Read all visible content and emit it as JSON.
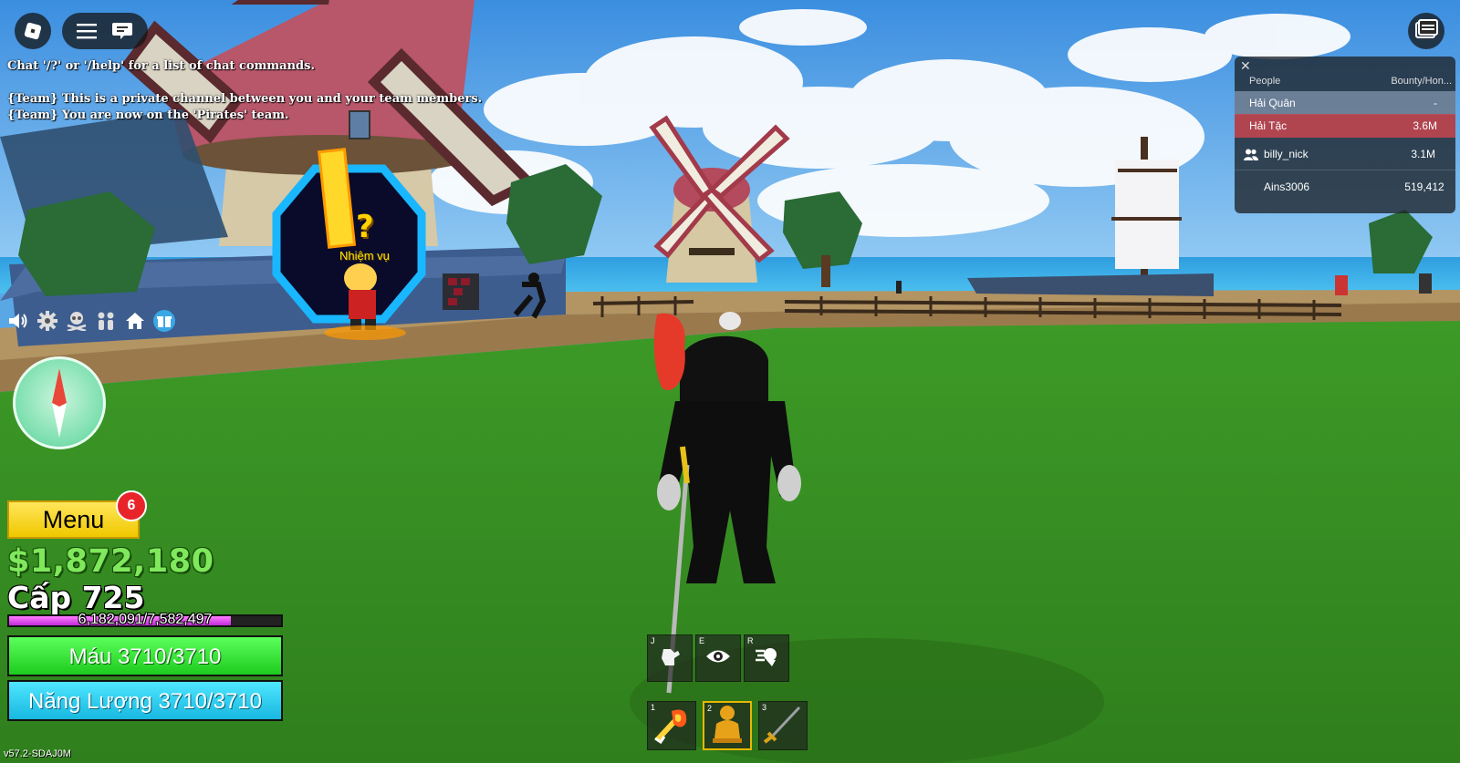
{
  "top_left": {
    "roblox_icon": "roblox-logo-icon",
    "menu_icon": "hamburger-icon",
    "chat_icon": "chat-bubble-icon"
  },
  "top_right": {
    "icon": "backpack-icon"
  },
  "chat": {
    "line1": "Chat '/?' or '/help' for a list of chat commands.",
    "line2": "{Team} This is a private channel between you and your team members.",
    "line3": "{Team} You are now on the 'Pirates' team."
  },
  "leaderboard": {
    "col_people": "People",
    "col_bounty": "Bounty/Hon...",
    "teams": [
      {
        "name": "Hải Quân",
        "value": "-"
      },
      {
        "name": "Hải Tặc",
        "value": "3.6M"
      }
    ],
    "players": [
      {
        "name": "billy_nick",
        "value": "3.1M"
      },
      {
        "name": "Ains3006",
        "value": "519,412"
      }
    ],
    "colors": {
      "navy": "#8296af",
      "pirates": "#c84650"
    }
  },
  "icon_row": [
    "speaker-icon",
    "gear-icon",
    "skull-crossbones-icon",
    "crew-icon",
    "home-icon",
    "gift-icon"
  ],
  "quest": {
    "mark": "?",
    "label": "Nhiệm vụ"
  },
  "hud": {
    "menu_label": "Menu",
    "menu_badge": "6",
    "money": "$1,872,180",
    "level": "Cấp 725",
    "xp_text": "6,182,091/7,582,497",
    "xp_fraction": 0.8153,
    "hp_text": "Máu 3710/3710",
    "hp_fraction": 1.0,
    "energy_text": "Năng Lượng 3710/3710",
    "energy_fraction": 1.0,
    "version": "v57.2-SDAJ0M"
  },
  "skills": [
    {
      "key": "J",
      "icon": "fist-icon"
    },
    {
      "key": "E",
      "icon": "eye-icon"
    },
    {
      "key": "R",
      "icon": "dash-icon"
    }
  ],
  "hotbar": [
    {
      "key": "1",
      "icon": "flame-fruit-icon"
    },
    {
      "key": "2",
      "icon": "fighting-style-icon"
    },
    {
      "key": "3",
      "icon": "sword-icon"
    }
  ]
}
